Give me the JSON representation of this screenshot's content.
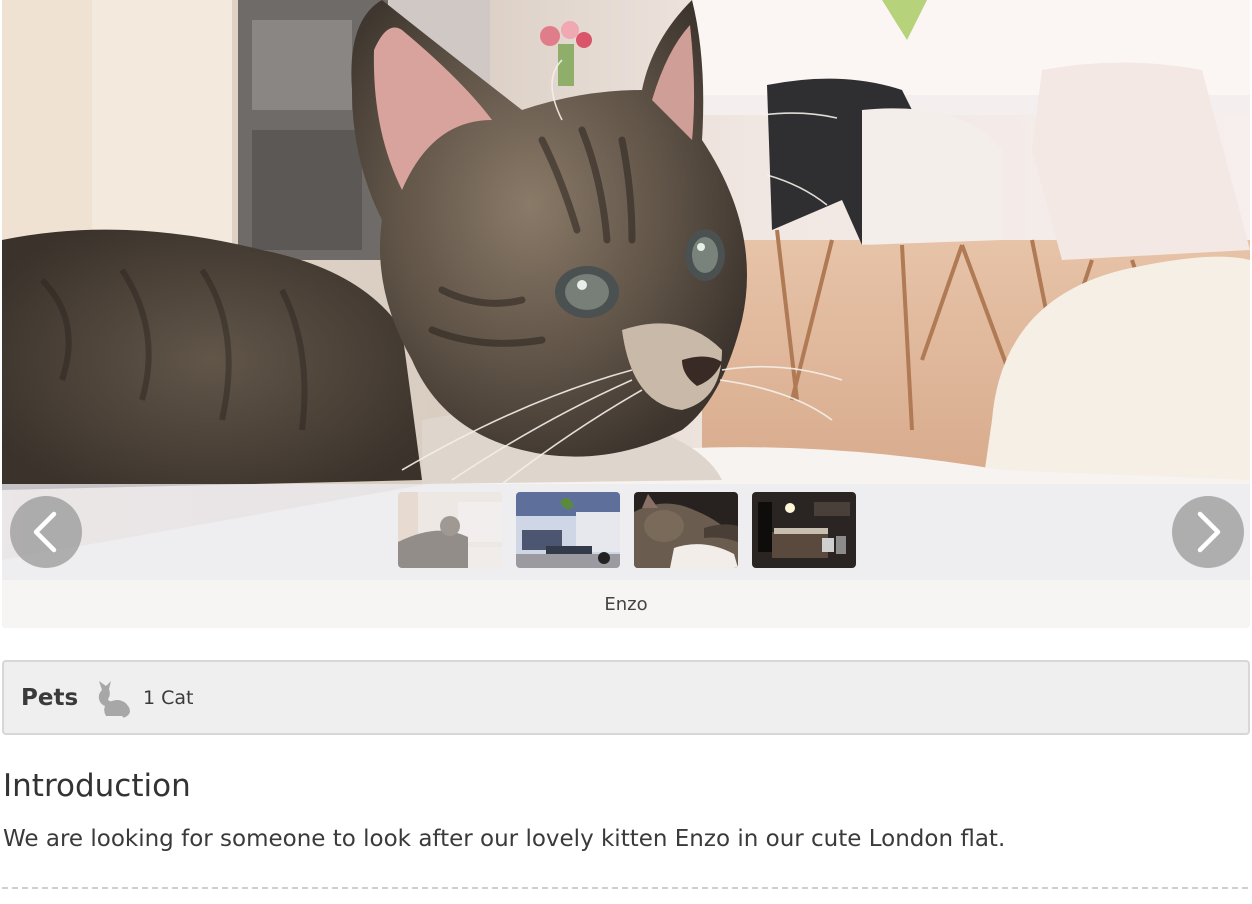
{
  "gallery": {
    "main_photo": "kitten-photo",
    "caption": "Enzo",
    "prev_icon": "chevron-left-icon",
    "next_icon": "chevron-right-icon",
    "thumbnails": [
      {
        "icon": "kitten-on-sofa-thumbnail"
      },
      {
        "icon": "patio-thumbnail"
      },
      {
        "icon": "sleeping-kitten-thumbnail"
      },
      {
        "icon": "kitchen-thumbnail"
      }
    ]
  },
  "pets": {
    "label": "Pets",
    "icon": "cat-icon",
    "count": "1 Cat"
  },
  "introduction": {
    "heading": "Introduction",
    "body": "We are looking for someone to look after our lovely kitten Enzo in our cute London flat."
  },
  "colors": {
    "page_background": "#ffffff",
    "pets_box_background": "#efefef",
    "pets_box_border": "#d7d7d7",
    "text": "#333333"
  }
}
